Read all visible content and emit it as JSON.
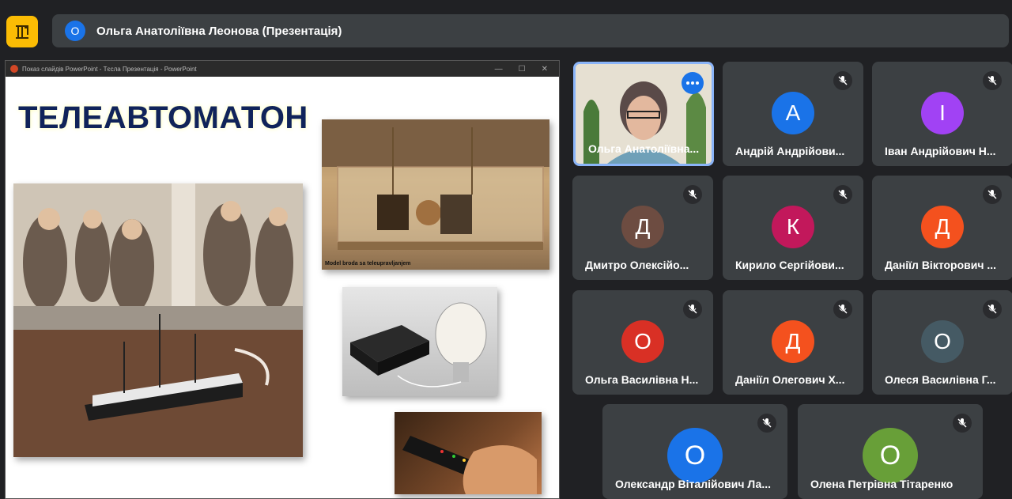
{
  "header": {
    "presenter_initial": "О",
    "presenter_title": "Ольга Анатоліївна Леонова (Презентація)"
  },
  "ppt": {
    "window_title": "Показ слайдів PowerPoint  -  Тєсла Презентація - PowerPoint",
    "slide_title": "ТЕЛЕАВТОМАТОН",
    "boat_caption": "Model broda sa teleupravljanjem"
  },
  "participants": [
    {
      "name": "Ольга Анатоліївна...",
      "initial": "",
      "color": "",
      "active": true
    },
    {
      "name": "Андрій Андрійови...",
      "initial": "А",
      "color": "#1a73e8"
    },
    {
      "name": "Іван Андрійович Н...",
      "initial": "І",
      "color": "#a142f4"
    },
    {
      "name": "Дмитро Олексійо...",
      "initial": "Д",
      "color": "#6d4c41"
    },
    {
      "name": "Кирило Сергійови...",
      "initial": "К",
      "color": "#c2185b"
    },
    {
      "name": "Даніїл Вікторович ...",
      "initial": "Д",
      "color": "#f4511e"
    },
    {
      "name": "Ольга Василівна Н...",
      "initial": "О",
      "color": "#d93025"
    },
    {
      "name": "Даніїл Олегович Х...",
      "initial": "Д",
      "color": "#f4511e"
    },
    {
      "name": "Олеся Василівна Г...",
      "initial": "О",
      "color": "#455a64"
    },
    {
      "name": "Олександр Віталійович Ла...",
      "initial": "О",
      "color": "#1a73e8"
    },
    {
      "name": "Олена Петрівна Тітаренко",
      "initial": "О",
      "color": "#689f38"
    }
  ]
}
